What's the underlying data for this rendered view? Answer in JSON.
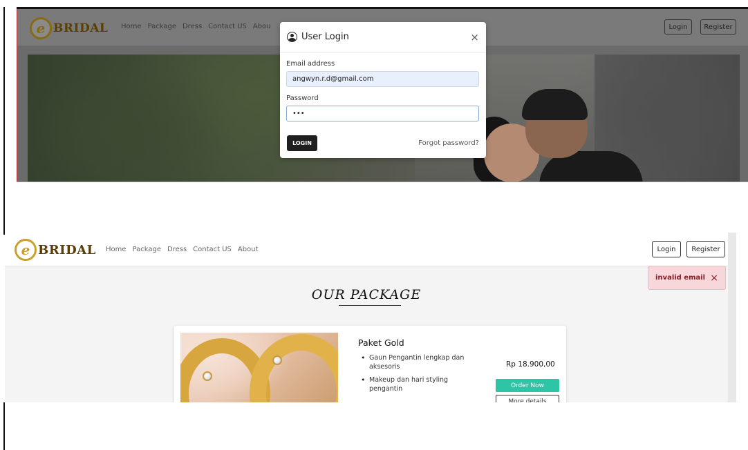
{
  "brand": {
    "logo_letter": "e",
    "name": "BRIDAL"
  },
  "nav": {
    "links": [
      "Home",
      "Package",
      "Dress",
      "Contact US",
      "About"
    ],
    "top_links_partial": [
      "Home",
      "Package",
      "Dress",
      "Contact US",
      "Abou"
    ],
    "login": "Login",
    "register": "Register"
  },
  "login_modal": {
    "title": "User Login",
    "close": "×",
    "email_label": "Email address",
    "email_value": "angwyn.r.d@gmail.com",
    "password_label": "Password",
    "password_value": "•••",
    "submit": "LOGIN",
    "forgot": "Forgot password?"
  },
  "toast": {
    "message": "invalid email",
    "close": "×",
    "color": "#f8d7da"
  },
  "packages_section": {
    "title": "OUR PACKAGE",
    "card": {
      "name": "Paket Gold",
      "features": [
        "Gaun Pengantin lengkap dan aksesoris",
        "Makeup dan hari styling pengantin"
      ],
      "price": "Rp 18.900,00",
      "order_label": "Order Now",
      "details_label": "More details"
    }
  },
  "colors": {
    "accent_green": "#2ec4a6",
    "brand_gold": "#c9a02c",
    "dark_button": "#1f1f1f"
  }
}
